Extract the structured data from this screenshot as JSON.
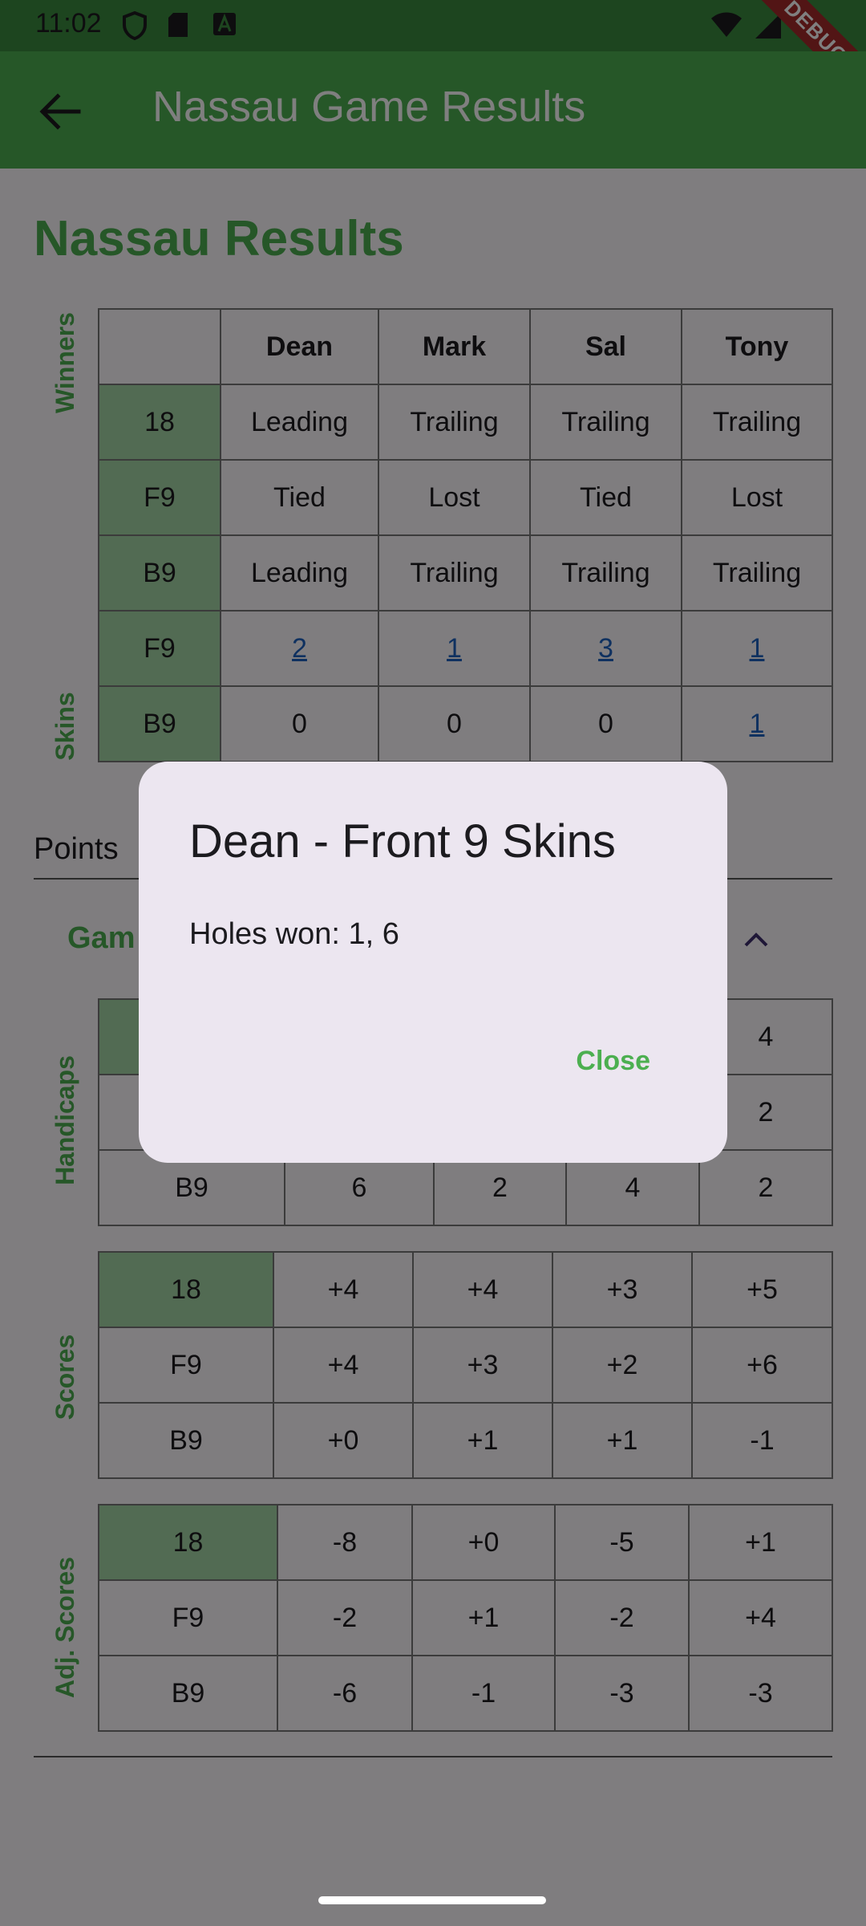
{
  "status_bar": {
    "time": "11:02",
    "debug_label": "DEBUG"
  },
  "app_bar": {
    "title": "Nassau Game Results"
  },
  "page": {
    "heading": "Nassau Results"
  },
  "labels": {
    "winners": "Winners",
    "skins": "Skins",
    "handicaps": "Handicaps",
    "scores": "Scores",
    "adj_scores": "Adj. Scores",
    "points": "Points",
    "games": "Gam"
  },
  "results_table": {
    "players": [
      "Dean",
      "Mark",
      "Sal",
      "Tony"
    ],
    "winners_rows": [
      {
        "label": "18",
        "values": [
          "Leading",
          "Trailing",
          "Trailing",
          "Trailing"
        ]
      },
      {
        "label": "F9",
        "values": [
          "Tied",
          "Lost",
          "Tied",
          "Lost"
        ]
      },
      {
        "label": "B9",
        "values": [
          "Leading",
          "Trailing",
          "Trailing",
          "Trailing"
        ]
      }
    ],
    "skins_rows": [
      {
        "label": "F9",
        "values": [
          "2",
          "1",
          "3",
          "1"
        ]
      },
      {
        "label": "B9",
        "values": [
          "0",
          "0",
          "0",
          "1"
        ]
      }
    ]
  },
  "handicaps_table": {
    "rows": [
      {
        "label": "",
        "values": [
          "",
          "",
          "",
          "4"
        ]
      },
      {
        "label": "",
        "values": [
          "",
          "",
          "",
          "2"
        ]
      },
      {
        "label": "B9",
        "values": [
          "6",
          "2",
          "4",
          "2"
        ]
      }
    ]
  },
  "scores_table": {
    "rows": [
      {
        "label": "18",
        "values": [
          "+4",
          "+4",
          "+3",
          "+5"
        ]
      },
      {
        "label": "F9",
        "values": [
          "+4",
          "+3",
          "+2",
          "+6"
        ]
      },
      {
        "label": "B9",
        "values": [
          "+0",
          "+1",
          "+1",
          "-1"
        ]
      }
    ]
  },
  "adj_scores_table": {
    "rows": [
      {
        "label": "18",
        "values": [
          "-8",
          "+0",
          "-5",
          "+1"
        ]
      },
      {
        "label": "F9",
        "values": [
          "-2",
          "+1",
          "-2",
          "+4"
        ]
      },
      {
        "label": "B9",
        "values": [
          "-6",
          "-1",
          "-3",
          "-3"
        ]
      }
    ]
  },
  "dialog": {
    "title": "Dean - Front 9 Skins",
    "body": "Holes won: 1, 6",
    "close_label": "Close"
  },
  "colors": {
    "primary": "#4caf50",
    "header_green": "#a5d6a7",
    "link": "#1e63c0",
    "dialog_bg": "#ece6f0"
  }
}
